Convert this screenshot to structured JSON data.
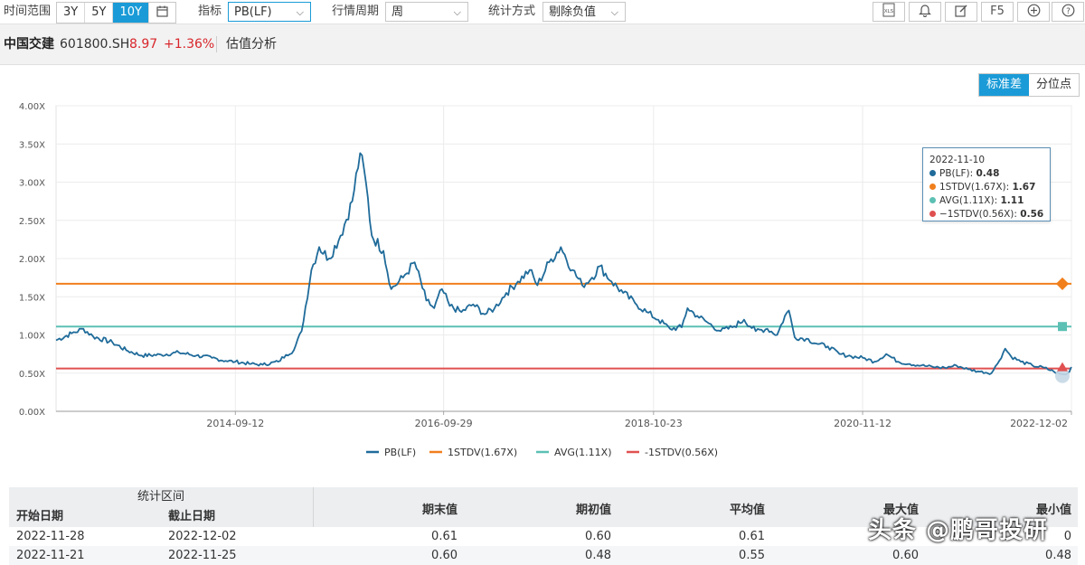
{
  "toolbar": {
    "time_range_label": "时间范围",
    "ranges": [
      "3Y",
      "5Y",
      "10Y"
    ],
    "active_range": "10Y",
    "indicator_label": "指标",
    "indicator_value": "PB(LF)",
    "period_label": "行情周期",
    "period_value": "周",
    "stat_label": "统计方式",
    "stat_value": "剔除负值",
    "icons": [
      "calendar-icon",
      "xls-export-icon",
      "bell-icon",
      "edit-icon",
      "f5-icon",
      "add-icon",
      "help-icon"
    ],
    "f5_label": "F5"
  },
  "stock": {
    "name": "中国交建",
    "code": "601800.SH",
    "price": "8.97",
    "change": "+1.36%",
    "module": "估值分析"
  },
  "toggle": {
    "std_label": "标准差",
    "pct_label": "分位点",
    "active": "标准差"
  },
  "colors": {
    "pb": "#1f6b9a",
    "stdv_up": "#f07f1c",
    "avg": "#5cc0b4",
    "stdv_down": "#e05050",
    "accent": "#1a9bd7"
  },
  "chart_data": {
    "type": "line",
    "x_ticks": [
      "2014-09-12",
      "2016-09-29",
      "2018-10-23",
      "2020-11-12",
      "2022-12-02"
    ],
    "y_ticks": [
      "0.00X",
      "0.50X",
      "1.00X",
      "1.50X",
      "2.00X",
      "2.50X",
      "3.00X",
      "3.50X",
      "4.00X"
    ],
    "ylim": [
      0,
      4
    ],
    "xlim": [
      "2012-12-07",
      "2022-12-02"
    ],
    "series": [
      {
        "name": "PB(LF)",
        "points": [
          [
            "2012-12-07",
            0.93
          ],
          [
            "2013-02-01",
            1.02
          ],
          [
            "2013-03-15",
            1.08
          ],
          [
            "2013-04-19",
            0.98
          ],
          [
            "2013-06-28",
            0.9
          ],
          [
            "2013-08-16",
            0.8
          ],
          [
            "2013-10-11",
            0.73
          ],
          [
            "2013-12-20",
            0.74
          ],
          [
            "2014-02-21",
            0.77
          ],
          [
            "2014-04-25",
            0.73
          ],
          [
            "2014-06-20",
            0.7
          ],
          [
            "2014-08-08",
            0.66
          ],
          [
            "2014-09-12",
            0.65
          ],
          [
            "2014-11-07",
            0.62
          ],
          [
            "2014-12-19",
            0.61
          ],
          [
            "2015-02-13",
            0.65
          ],
          [
            "2015-03-13",
            0.74
          ],
          [
            "2015-04-10",
            0.8
          ],
          [
            "2015-05-08",
            1.05
          ],
          [
            "2015-06-12",
            1.85
          ],
          [
            "2015-07-10",
            2.15
          ],
          [
            "2015-08-14",
            2.0
          ],
          [
            "2015-09-25",
            2.3
          ],
          [
            "2015-11-06",
            2.75
          ],
          [
            "2015-12-04",
            3.38
          ],
          [
            "2015-12-25",
            3.0
          ],
          [
            "2016-01-15",
            2.3
          ],
          [
            "2016-02-26",
            2.1
          ],
          [
            "2016-03-25",
            1.6
          ],
          [
            "2016-05-06",
            1.75
          ],
          [
            "2016-06-17",
            1.95
          ],
          [
            "2016-07-29",
            1.45
          ],
          [
            "2016-08-26",
            1.35
          ],
          [
            "2016-09-23",
            1.6
          ],
          [
            "2016-10-21",
            1.38
          ],
          [
            "2016-12-02",
            1.3
          ],
          [
            "2017-01-13",
            1.4
          ],
          [
            "2017-02-24",
            1.27
          ],
          [
            "2017-03-31",
            1.35
          ],
          [
            "2017-05-12",
            1.55
          ],
          [
            "2017-06-23",
            1.7
          ],
          [
            "2017-08-04",
            1.85
          ],
          [
            "2017-09-01",
            1.65
          ],
          [
            "2017-10-13",
            1.95
          ],
          [
            "2017-11-24",
            2.15
          ],
          [
            "2018-01-05",
            1.85
          ],
          [
            "2018-02-09",
            1.65
          ],
          [
            "2018-03-16",
            1.75
          ],
          [
            "2018-04-13",
            1.9
          ],
          [
            "2018-05-25",
            1.7
          ],
          [
            "2018-07-06",
            1.55
          ],
          [
            "2018-08-17",
            1.42
          ],
          [
            "2018-09-28",
            1.3
          ],
          [
            "2018-11-09",
            1.2
          ],
          [
            "2018-12-21",
            1.08
          ],
          [
            "2019-02-01",
            1.1
          ],
          [
            "2019-02-22",
            1.35
          ],
          [
            "2019-03-29",
            1.25
          ],
          [
            "2019-05-10",
            1.15
          ],
          [
            "2019-06-21",
            1.05
          ],
          [
            "2019-08-02",
            1.1
          ],
          [
            "2019-09-13",
            1.2
          ],
          [
            "2019-10-25",
            1.05
          ],
          [
            "2019-12-06",
            1.08
          ],
          [
            "2020-01-10",
            1.0
          ],
          [
            "2020-02-07",
            1.25
          ],
          [
            "2020-02-21",
            1.32
          ],
          [
            "2020-03-13",
            0.97
          ],
          [
            "2020-04-24",
            0.95
          ],
          [
            "2020-06-05",
            0.88
          ],
          [
            "2020-07-10",
            0.85
          ],
          [
            "2020-08-21",
            0.75
          ],
          [
            "2020-10-02",
            0.72
          ],
          [
            "2020-11-13",
            0.7
          ],
          [
            "2020-12-25",
            0.65
          ],
          [
            "2021-02-05",
            0.75
          ],
          [
            "2021-03-19",
            0.65
          ],
          [
            "2021-04-30",
            0.62
          ],
          [
            "2021-06-11",
            0.6
          ],
          [
            "2021-07-23",
            0.58
          ],
          [
            "2021-09-03",
            0.57
          ],
          [
            "2021-10-15",
            0.6
          ],
          [
            "2021-11-26",
            0.55
          ],
          [
            "2022-01-07",
            0.52
          ],
          [
            "2022-02-18",
            0.5
          ],
          [
            "2022-03-11",
            0.62
          ],
          [
            "2022-04-08",
            0.82
          ],
          [
            "2022-04-29",
            0.72
          ],
          [
            "2022-06-03",
            0.65
          ],
          [
            "2022-07-15",
            0.6
          ],
          [
            "2022-08-26",
            0.57
          ],
          [
            "2022-09-30",
            0.52
          ],
          [
            "2022-10-21",
            0.49
          ],
          [
            "2022-11-10",
            0.48
          ],
          [
            "2022-11-25",
            0.52
          ],
          [
            "2022-12-02",
            0.58
          ]
        ]
      },
      {
        "name": "1STDV(1.67X)",
        "value": 1.67
      },
      {
        "name": "AVG(1.11X)",
        "value": 1.11
      },
      {
        "name": "-1STDV(0.56X)",
        "value": 0.56
      }
    ],
    "legend": [
      "PB(LF)",
      "1STDV(1.67X)",
      "AVG(1.11X)",
      "-1STDV(0.56X)"
    ],
    "legend_position": "bottom",
    "grid": true,
    "tooltip": {
      "date": "2022-11-10",
      "rows": [
        {
          "label": "PB(LF): ",
          "value": "0.48"
        },
        {
          "label": "1STDV(1.67X): ",
          "value": "1.67"
        },
        {
          "label": "AVG(1.11X): ",
          "value": "1.11"
        },
        {
          "label": "−1STDV(0.56X): ",
          "value": "0.56"
        }
      ]
    }
  },
  "table": {
    "group_header": "统计区间",
    "headers": [
      "开始日期",
      "截止日期",
      "期末值",
      "期初值",
      "平均值",
      "最大值",
      "最小值"
    ],
    "rows": [
      [
        "2022-11-28",
        "2022-12-02",
        "0.61",
        "0.60",
        "0.61",
        "",
        "0"
      ],
      [
        "2022-11-21",
        "2022-11-25",
        "0.60",
        "0.48",
        "0.55",
        "0.60",
        "0.48"
      ]
    ]
  },
  "watermark": "头条 @鹏哥投研"
}
